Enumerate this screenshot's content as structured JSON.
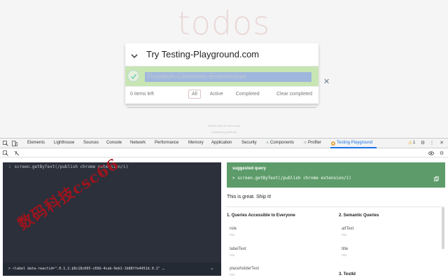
{
  "app": {
    "title": "todos",
    "new_todo_text": "Try Testing-Playground.com",
    "todo_item": "Publish Chrome Extension",
    "destroy_glyph": "✕",
    "footer": {
      "count": "0 items left",
      "filters": [
        "All",
        "Active",
        "Completed"
      ],
      "selected_filter": "All",
      "clear": "Clear completed"
    },
    "info": [
      "Double-click to edit a todo",
      "Created by petehunt"
    ]
  },
  "devtools": {
    "tabs": [
      "Elements",
      "Lighthouse",
      "Sources",
      "Console",
      "Network",
      "Performance",
      "Memory",
      "Application",
      "Security",
      "Components",
      "Profiler",
      "Testing Playground"
    ],
    "active_tab": "Testing Playground",
    "warnings_count": "1",
    "accent": "#1a73e8"
  },
  "playground": {
    "editor_line_number": "1",
    "editor_code": "screen.getByText(/publish chrome extension/i)",
    "result_text": "> <label data-reactid=\".0.1.2.$8c18c665-c69b-4cab-9eb1-1b88ffe4451d.0.1\" …",
    "suggested_title": "suggested query",
    "suggested_code": "> screen.getByText(/publish chrome extension/i)",
    "suggested_color": "#5d9c6a",
    "ship_it": "This is great. Ship it!",
    "sections": {
      "accessible": {
        "heading": "1. Queries Accessible to Everyone",
        "items": [
          {
            "label": "role",
            "value": "n/a"
          },
          {
            "label": "labelText",
            "value": "n/a"
          },
          {
            "label": "placeholderText",
            "value": "n/a"
          }
        ]
      },
      "semantic": {
        "heading": "2. Semantic Queries",
        "items": [
          {
            "label": "altText",
            "value": "n/a"
          },
          {
            "label": "title",
            "value": "n/a"
          }
        ]
      },
      "testid": {
        "heading": "3. TestId"
      }
    }
  },
  "watermark": "数码科技csc66"
}
